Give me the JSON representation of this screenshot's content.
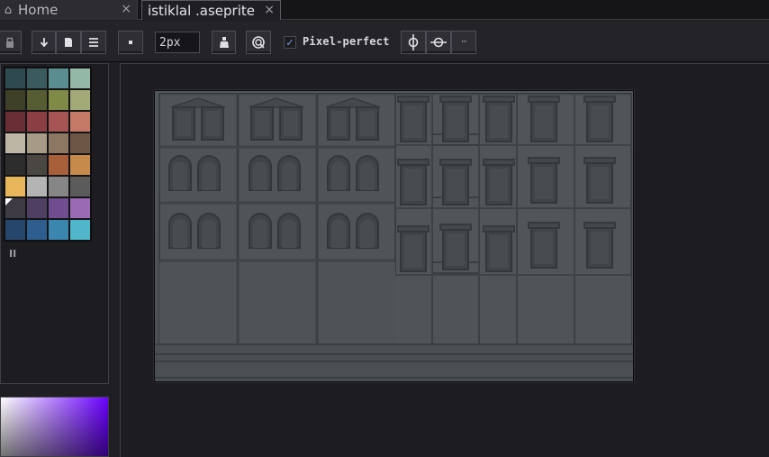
{
  "tabs": [
    {
      "label": "Home",
      "icon": "home-icon",
      "close": "×"
    },
    {
      "label": "istiklal .aseprite",
      "icon": "",
      "close": "×"
    }
  ],
  "toolbar": {
    "lock_icon": "lock-icon",
    "brush_size": "2px",
    "pixel_perfect_label": "Pixel-perfect",
    "pixel_perfect_checked": true,
    "more_label": "···"
  },
  "palette": {
    "colors": [
      "#2f4a4f",
      "#3b5a5e",
      "#5a8d8f",
      "#93b8a6",
      "#3d3f26",
      "#575d32",
      "#7f8a46",
      "#a4aa77",
      "#6a2f36",
      "#8c3e45",
      "#a65554",
      "#c57a66",
      "#bdb6a4",
      "#a69b86",
      "#8b7762",
      "#6c5646",
      "#2e2d2d",
      "#4a4641",
      "#a8603b",
      "#c68a4a",
      "#e8b65a",
      "#b4b4b4",
      "#868686",
      "#5b5b5b",
      "#3d3a44",
      "#4f3f63",
      "#6f4d8e",
      "#9a6ab4",
      "#27466b",
      "#2d5e8d",
      "#3a86ae",
      "#4fb7c9"
    ],
    "selected_index": 24,
    "pause_label": "II"
  },
  "colors": {
    "accent": "#6a00ff",
    "building_base": "#51565a",
    "building_dark": "#3a3e42"
  }
}
